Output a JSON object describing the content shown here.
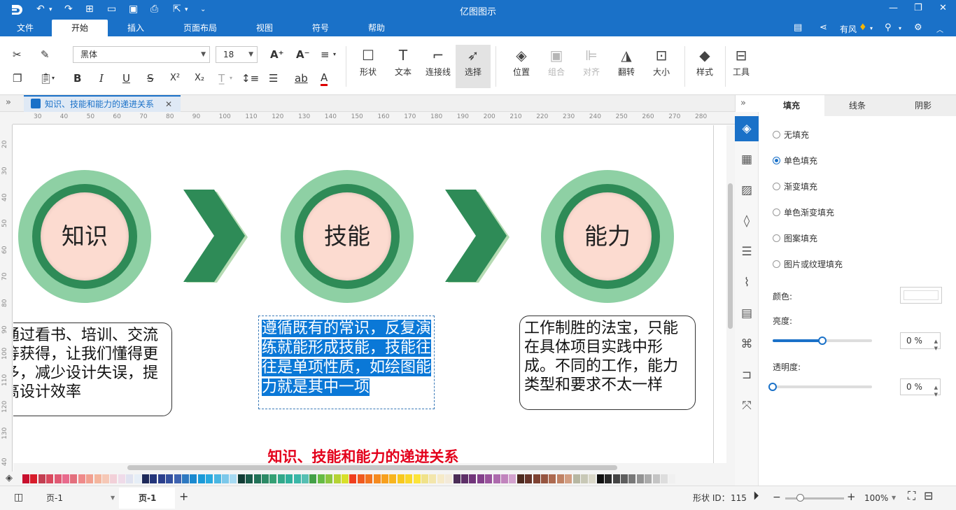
{
  "app": {
    "title": "亿图图示"
  },
  "menu": {
    "items": [
      "文件",
      "开始",
      "插入",
      "页面布局",
      "视图",
      "符号",
      "帮助"
    ],
    "active": "开始"
  },
  "user": {
    "name": "有风"
  },
  "ribbon": {
    "font_name": "黑体",
    "font_size": "18",
    "buttons": {
      "shape": "形状",
      "text": "文本",
      "connector": "连接线",
      "select": "选择",
      "position": "位置",
      "group": "组合",
      "align": "对齐",
      "flip": "翻转",
      "size": "大小",
      "style": "样式",
      "tools": "工具"
    },
    "glyphs": {
      "bold": "B",
      "italic": "I",
      "underline": "U",
      "strike": "S",
      "sup": "X²",
      "sub": "X₂",
      "grow": "A⁺",
      "shrink": "A⁻"
    }
  },
  "doc_tab": {
    "name": "知识、技能和能力的递进关系"
  },
  "ruler": {
    "h": [
      "30",
      "40",
      "50",
      "60",
      "70",
      "80",
      "90",
      "100",
      "110",
      "120",
      "130",
      "140",
      "150",
      "160",
      "170",
      "180",
      "190",
      "200",
      "210",
      "220",
      "230",
      "240",
      "250",
      "260",
      "270",
      "280"
    ],
    "v": [
      "20",
      "30",
      "40",
      "50",
      "60",
      "70",
      "80",
      "90",
      "100",
      "110",
      "120",
      "130",
      "40"
    ]
  },
  "diagram": {
    "nodes": [
      "知识",
      "技能",
      "能力"
    ],
    "texts": [
      "通过看书、培训、交流等获得，让我们懂得更多，减少设计失误，提高设计效率",
      "遵循既有的常识，反复演练就能形成技能，技能往往是单项性质，如绘图能力就是其中一项",
      "工作制胜的法宝，只能在具体项目实践中形成。不同的工作，能力类型和要求不太一样"
    ],
    "text1_lines": [
      "通过看书、培训、交流",
      "等获得，让我们懂得更",
      "多，减少设计失误，提",
      "高设计效率"
    ],
    "title": "知识、技能和能力的递进关系",
    "colors": {
      "light_green": "#8ed0a4",
      "dark_green": "#2e8b57",
      "pink": "#fcdbd0",
      "title_red": "#e3001b"
    }
  },
  "palette": [
    "#c8102e",
    "#d71c2a",
    "#c33f52",
    "#d9495e",
    "#e05a74",
    "#e86b8d",
    "#e36f7d",
    "#ef8a8a",
    "#f1a090",
    "#f4b59d",
    "#f6c8b6",
    "#f2d0d8",
    "#efdbe9",
    "#dfe2f0",
    "#e6eef7",
    "#1f2a5a",
    "#24357a",
    "#2b3f8c",
    "#34509e",
    "#3e63b0",
    "#2f79c1",
    "#1b89cf",
    "#1b9ad8",
    "#29a9df",
    "#4ab6e2",
    "#7cc8ea",
    "#a7daf2",
    "#123c35",
    "#1b5b4a",
    "#227258",
    "#2d8a66",
    "#35a074",
    "#32a88a",
    "#2fb09c",
    "#3ab7a8",
    "#56bfb3",
    "#43a047",
    "#66bb44",
    "#8cc63f",
    "#b5d334",
    "#d8e02a",
    "#f03e1e",
    "#f05a1f",
    "#f27320",
    "#f58a20",
    "#f7a01f",
    "#f8b51e",
    "#f8c81e",
    "#fad72a",
    "#fce43a",
    "#f0e28a",
    "#f3e6ac",
    "#f6eac8",
    "#f3ead9",
    "#4b2d57",
    "#5e3068",
    "#71357a",
    "#83408a",
    "#9a539c",
    "#ad6aad",
    "#c184bd",
    "#d3a2ce",
    "#4d2a20",
    "#66342a",
    "#7e4232",
    "#965540",
    "#ad6a50",
    "#c08264",
    "#d29e82",
    "#b7b7a2",
    "#c8c8b6",
    "#dad8c9",
    "#111111",
    "#2a2a2a",
    "#444444",
    "#5e5e5e",
    "#787878",
    "#929292",
    "#ababab",
    "#c4c4c4",
    "#dddddd",
    "#f0f0f0"
  ],
  "status": {
    "page_select": "页-1",
    "page_tab": "页-1",
    "add": "+",
    "shape_id_label": "形状 ID：",
    "shape_id": "115",
    "zoom": "100%"
  },
  "panel": {
    "tabs": [
      "填充",
      "线条",
      "阴影"
    ],
    "fill_options": [
      "无填充",
      "单色填充",
      "渐变填充",
      "单色渐变填充",
      "图案填充",
      "图片或纹理填充"
    ],
    "selected_fill": 1,
    "color_label": "颜色:",
    "brightness_label": "亮度:",
    "brightness_value": "0 %",
    "brightness_level": 0.5,
    "transparency_label": "透明度:",
    "transparency_value": "0 %",
    "transparency_level": 0
  }
}
